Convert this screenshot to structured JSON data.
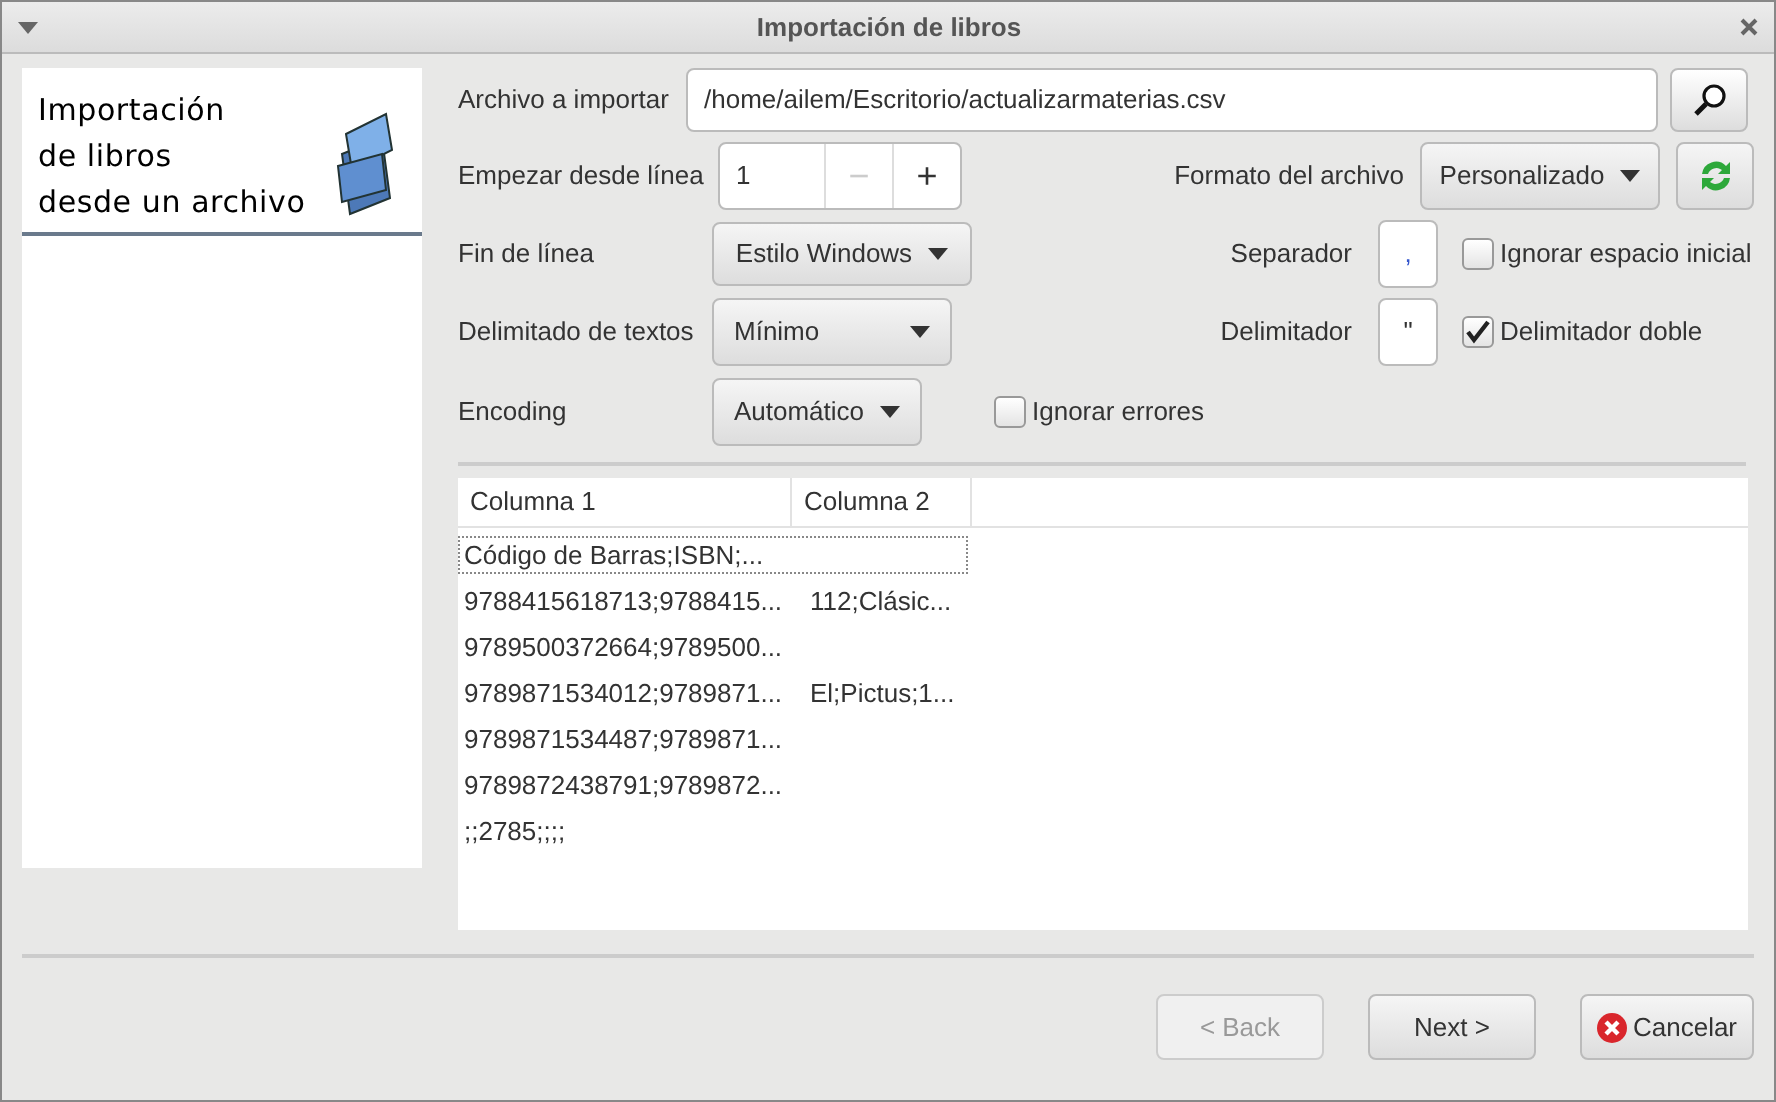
{
  "window": {
    "title": "Importación de libros"
  },
  "sidebar": {
    "title_lines": [
      "Importación",
      "de libros",
      "desde un archivo"
    ]
  },
  "file": {
    "label": "Archivo a importar",
    "value": "/home/ailem/Escritorio/actualizarmaterias.csv"
  },
  "start_line": {
    "label": "Empezar desde línea",
    "value": "1",
    "decrement": "−",
    "increment": "+",
    "decrement_disabled": true
  },
  "format": {
    "label": "Formato del archivo",
    "value": "Personalizado"
  },
  "line_end": {
    "label": "Fin de línea",
    "value": "Estilo Windows"
  },
  "separator": {
    "label": "Separador",
    "value": ","
  },
  "ignore_space": {
    "label": "Ignorar espacio inicial",
    "checked": false
  },
  "text_delimit": {
    "label": "Delimitado de textos",
    "value": "Mínimo"
  },
  "delimiter": {
    "label": "Delimitador",
    "value": "\""
  },
  "double_delimiter": {
    "label": "Delimitador doble",
    "checked": true
  },
  "encoding": {
    "label": "Encoding",
    "value": "Automático"
  },
  "ignore_errors": {
    "label": "Ignorar errores",
    "checked": false
  },
  "table": {
    "columns": [
      "Columna 1",
      "Columna 2"
    ],
    "rows": [
      {
        "cells": [
          "Código de Barras;ISBN;..."
        ],
        "selected": true
      },
      {
        "cells": [
          "9788415618713;9788415...",
          "112;Clásic..."
        ],
        "selected": false
      },
      {
        "cells": [
          "9789500372664;9789500..."
        ],
        "selected": false
      },
      {
        "cells": [
          "9789871534012;9789871...",
          "El;Pictus;1..."
        ],
        "selected": false
      },
      {
        "cells": [
          "9789871534487;9789871..."
        ],
        "selected": false
      },
      {
        "cells": [
          "9789872438791;9789872..."
        ],
        "selected": false
      },
      {
        "cells": [
          ";;2785;;;;"
        ],
        "selected": false
      }
    ]
  },
  "buttons": [
    {
      "label": "< Back",
      "disabled": true
    },
    {
      "label": "Next >",
      "disabled": false
    },
    {
      "label": "Cancelar",
      "disabled": false,
      "kind": "cancel"
    }
  ]
}
